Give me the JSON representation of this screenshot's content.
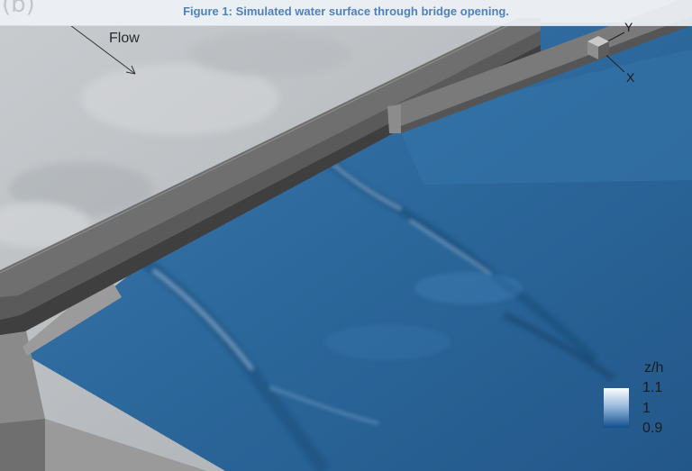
{
  "caption": "Figure 1: Simulated water surface through bridge opening.",
  "panel_label": "(b)",
  "flow_label": "Flow",
  "axes": {
    "y": "Y",
    "x": "X"
  },
  "legend": {
    "title": "z/h",
    "ticks": [
      "1.1",
      "1",
      "0.9"
    ]
  },
  "colors": {
    "water": "#2e6aa0",
    "water_dark": "#174a7a",
    "bridge": "#7d7d7d",
    "bed": "#c2c6c9",
    "caption": "#4f81bd"
  }
}
